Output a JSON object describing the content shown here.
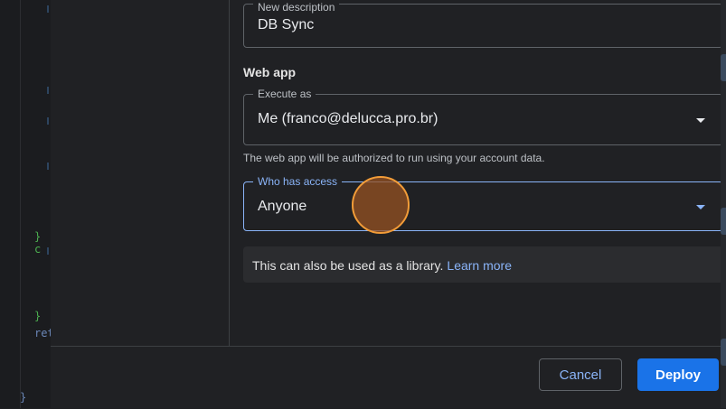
{
  "editor": {
    "close_brace_1": "} c",
    "close_brace_2": "}",
    "return_fragment": "ret",
    "close_brace_3": "}"
  },
  "dialog": {
    "description_field": {
      "label": "New description",
      "value": "DB Sync"
    },
    "web_app": {
      "section_title": "Web app",
      "execute_as": {
        "label": "Execute as",
        "value": "Me (franco@delucca.pro.br)"
      },
      "helper_text": "The web app will be authorized to run using your account data.",
      "who_has_access": {
        "label": "Who has access",
        "value": "Anyone"
      }
    },
    "info": {
      "text": "This can also be used as a library.",
      "link": "Learn more"
    },
    "footer": {
      "cancel_label": "Cancel",
      "deploy_label": "Deploy"
    }
  },
  "colors": {
    "accent": "#8ab4f8",
    "primary_button": "#1a73e8",
    "dialog_bg": "#202124",
    "cursor_highlight": "#f29c38"
  }
}
